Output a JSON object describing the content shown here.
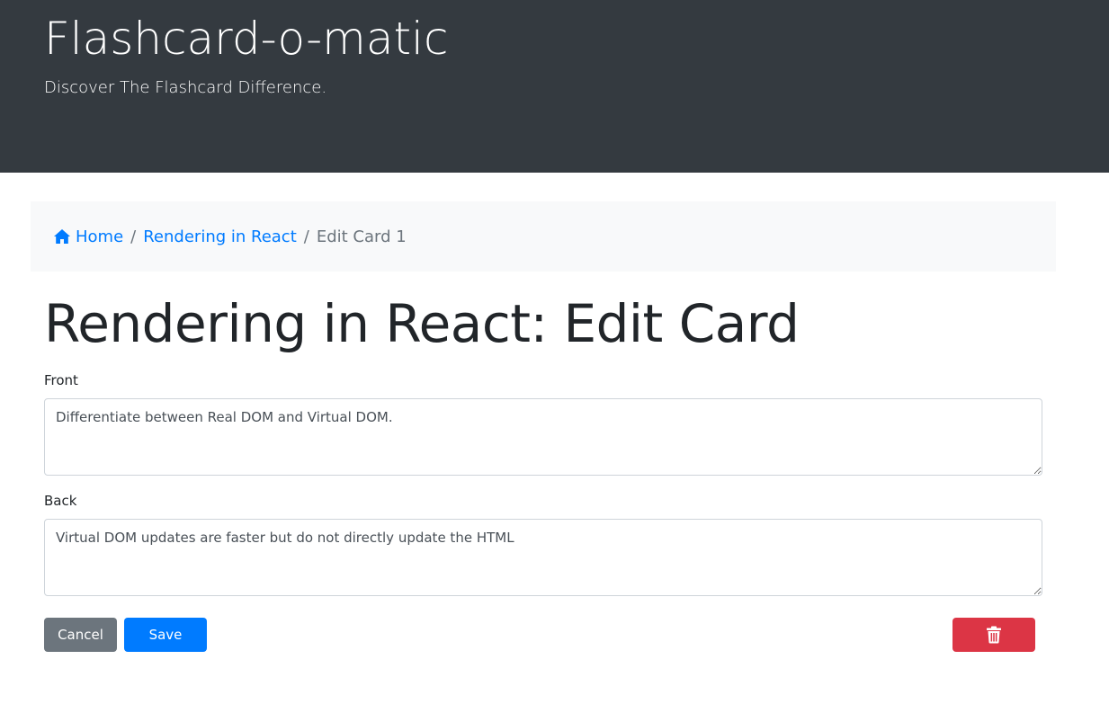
{
  "header": {
    "title": "Flashcard-o-matic",
    "tagline": "Discover The Flashcard Difference."
  },
  "breadcrumb": {
    "home_icon": "home-icon",
    "home_label": "Home",
    "separator": "/",
    "deck_label": "Rendering in React",
    "current_label": "Edit Card 1"
  },
  "page": {
    "title": "Rendering in React: Edit Card"
  },
  "form": {
    "front": {
      "label": "Front",
      "value": "Differentiate between Real DOM and Virtual DOM."
    },
    "back": {
      "label": "Back",
      "value": "Virtual DOM updates are faster but do not directly update the HTML"
    }
  },
  "buttons": {
    "cancel_label": "Cancel",
    "save_label": "Save",
    "delete_icon": "trash-icon"
  },
  "colors": {
    "header_bg": "#343a40",
    "breadcrumb_bg": "#f8f9fa",
    "link": "#007bff",
    "secondary": "#6c757d",
    "primary": "#007bff",
    "danger": "#dc3545"
  }
}
